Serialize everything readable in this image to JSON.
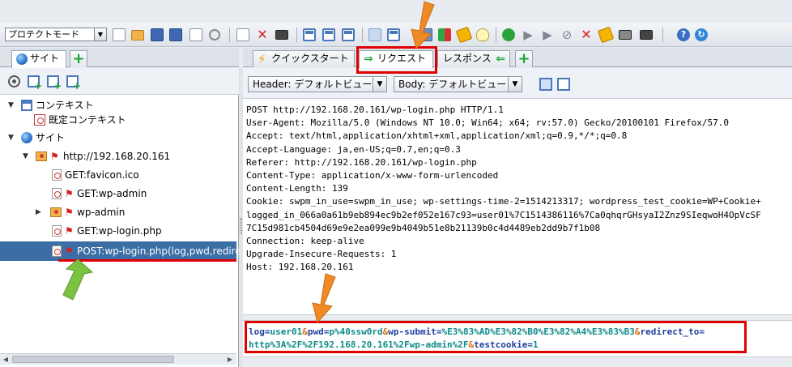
{
  "toolbar": {
    "mode": "プロテクトモード"
  },
  "left_tabs": {
    "sites_label": "サイト"
  },
  "right_tabs": {
    "quick_start_label": "クイックスタート",
    "request_label": "リクエスト",
    "response_label": "レスポンス"
  },
  "tree": {
    "contexts_label": "コンテキスト",
    "default_context_label": "既定コンテキスト",
    "sites_label": "サイト",
    "host_label": "http://192.168.20.161",
    "children": [
      {
        "label": "GET:favicon.ico"
      },
      {
        "label": "GET:wp-admin"
      },
      {
        "label": "wp-admin"
      },
      {
        "label": "GET:wp-login.php"
      },
      {
        "label": "POST:wp-login.php(log,pwd,redirect"
      }
    ]
  },
  "view_bar": {
    "header_view": "Header: デフォルトビュー",
    "body_view": "Body: デフォルトビュー"
  },
  "request_headers": [
    "POST http://192.168.20.161/wp-login.php HTTP/1.1",
    "User-Agent: Mozilla/5.0 (Windows NT 10.0; Win64; x64; rv:57.0) Gecko/20100101 Firefox/57.0",
    "Accept: text/html,application/xhtml+xml,application/xml;q=0.9,*/*;q=0.8",
    "Accept-Language: ja,en-US;q=0.7,en;q=0.3",
    "Referer: http://192.168.20.161/wp-login.php",
    "Content-Type: application/x-www-form-urlencoded",
    "Content-Length: 139",
    "Cookie: swpm_in_use=swpm_in_use; wp-settings-time-2=1514213317; wordpress_test_cookie=WP+Cookie+",
    "logged_in_066a0a61b9eb894ec9b2ef052e167c93=user01%7C1514386116%7Ca0qhqrGHsyaI2Znz9SIeqwoH4OpVcSF",
    "7C15d981cb4504d69e9e2ea099e9b4049b51e8b21139b0c4d4489eb2dd9b7f1b08",
    "Connection: keep-alive",
    "Upgrade-Insecure-Requests: 1",
    "Host: 192.168.20.161"
  ],
  "request_body": {
    "log_key": "log",
    "log_value": "user01",
    "pwd_key": "pwd",
    "pwd_value": "p%40ssw0rd",
    "submit_key": "wp-submit",
    "submit_value": "%E3%83%AD%E3%82%B0%E3%82%A4%E3%83%B3",
    "redirect_key": "redirect_to",
    "redirect_value": "http%3A%2F%2F192.168.20.161%2Fwp-admin%2F",
    "testcookie_key": "testcookie",
    "testcookie_value": "1",
    "amp": "&",
    "eq": "="
  },
  "colors": {
    "highlight_red": "#e00000",
    "annotation_orange": "#f08a24",
    "annotation_green": "#7cc242",
    "selection_blue": "#3a6ea5"
  }
}
